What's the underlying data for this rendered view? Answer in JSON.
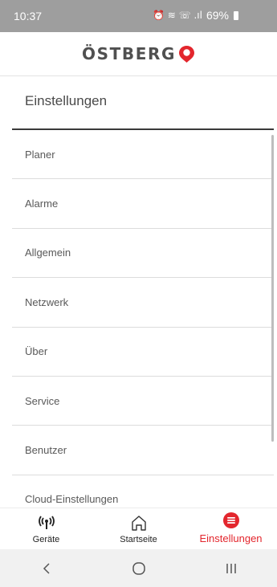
{
  "status_bar": {
    "time": "10:37",
    "indicators": "⏰ ≋ ☏ .ıl",
    "battery": "69%"
  },
  "brand": {
    "logo_text": "ÖSTBERG",
    "logo_mark_icon": "red-drop-logo",
    "accent_color": "#e3262d"
  },
  "page": {
    "title": "Einstellungen"
  },
  "settings_menu": {
    "items": [
      {
        "label": "Planer"
      },
      {
        "label": "Alarme"
      },
      {
        "label": "Allgemein"
      },
      {
        "label": "Netzwerk"
      },
      {
        "label": "Über"
      },
      {
        "label": "Service"
      },
      {
        "label": "Benutzer"
      },
      {
        "label": "Cloud-Einstellungen"
      }
    ]
  },
  "bottom_nav": {
    "items": [
      {
        "label": "Geräte",
        "icon": "antenna-icon",
        "active": false
      },
      {
        "label": "Startseite",
        "icon": "home-icon",
        "active": false
      },
      {
        "label": "Einstellungen",
        "icon": "menu-circle-icon",
        "active": true
      }
    ]
  },
  "system_nav": {
    "back_icon": "back-chevron-icon",
    "home_icon": "home-circle-icon",
    "recents_icon": "recents-icon"
  }
}
